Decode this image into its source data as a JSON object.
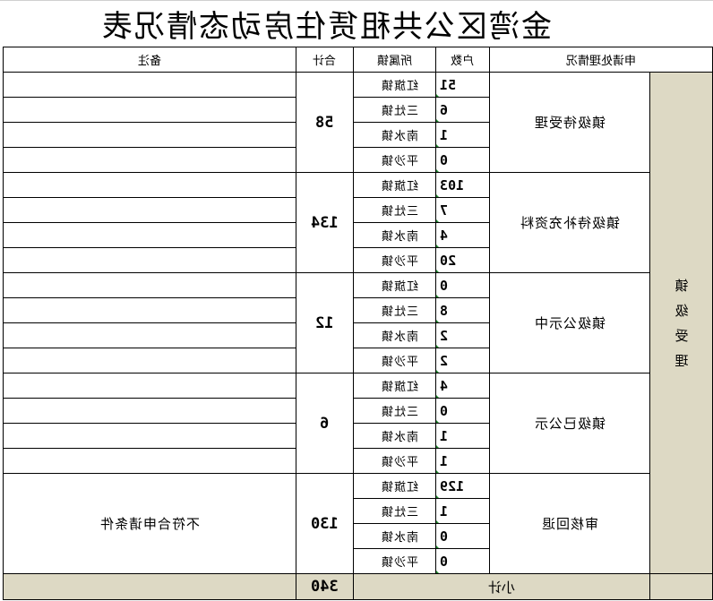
{
  "title": "金湾区公共租赁住房动态情况表",
  "headers": {
    "remark": "备注",
    "total": "合计",
    "town": "所属镇",
    "count": "户数",
    "status": "申请处理情况"
  },
  "side_label": "镇级受理",
  "groups": [
    {
      "status": "镇级待受理",
      "total": "58",
      "remark": "",
      "rows": [
        {
          "count": "51",
          "town": "红旗镇"
        },
        {
          "count": "6",
          "town": "三灶镇"
        },
        {
          "count": "1",
          "town": "南水镇"
        },
        {
          "count": "0",
          "town": "平沙镇"
        }
      ]
    },
    {
      "status": "镇级待补充资料",
      "total": "134",
      "remark": "",
      "rows": [
        {
          "count": "103",
          "town": "红旗镇"
        },
        {
          "count": "7",
          "town": "三灶镇"
        },
        {
          "count": "4",
          "town": "南水镇"
        },
        {
          "count": "20",
          "town": "平沙镇"
        }
      ]
    },
    {
      "status": "镇级公示中",
      "total": "12",
      "remark": "",
      "rows": [
        {
          "count": "0",
          "town": "红旗镇"
        },
        {
          "count": "8",
          "town": "三灶镇"
        },
        {
          "count": "2",
          "town": "南水镇"
        },
        {
          "count": "2",
          "town": "平沙镇"
        }
      ]
    },
    {
      "status": "镇级已公示",
      "total": "6",
      "remark": "",
      "rows": [
        {
          "count": "4",
          "town": "红旗镇"
        },
        {
          "count": "0",
          "town": "三灶镇"
        },
        {
          "count": "1",
          "town": "南水镇"
        },
        {
          "count": "1",
          "town": "平沙镇"
        }
      ]
    },
    {
      "status": "审核回退",
      "total": "130",
      "remark": "不符合申请条件",
      "rows": [
        {
          "count": "129",
          "town": "红旗镇"
        },
        {
          "count": "1",
          "town": "三灶镇"
        },
        {
          "count": "0",
          "town": "南水镇"
        },
        {
          "count": "0",
          "town": "平沙镇"
        }
      ]
    }
  ],
  "subtotal": {
    "label": "小计",
    "value": "340"
  },
  "colors": {
    "side_fill": "#ddd9c4",
    "corner_mark": "#1f8a2e"
  }
}
